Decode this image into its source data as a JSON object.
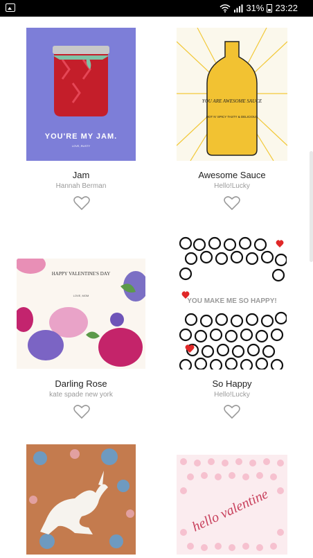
{
  "status_bar": {
    "battery": "31%",
    "time": "23:22"
  },
  "cards": [
    {
      "title": "Jam",
      "artist": "Hannah Berman",
      "image_text": "YOU'RE MY JAM.",
      "image_subtext": "LOVE, RUSTY"
    },
    {
      "title": "Awesome Sauce",
      "artist": "Hello!Lucky",
      "image_text": "YOU ARE AWESOME SAUCE",
      "image_subtext": "HOT N' SPICY TASTY & DELICIOUS"
    },
    {
      "title": "Darling Rose",
      "artist": "kate spade new york",
      "image_text": "HAPPY VALENTINE'S DAY",
      "image_subtext": "LOVE, MOM"
    },
    {
      "title": "So Happy",
      "artist": "Hello!Lucky",
      "image_text": "YOU MAKE ME SO HAPPY!",
      "image_subtext": ""
    },
    {
      "title": "",
      "artist": "",
      "image_text": "",
      "image_subtext": ""
    },
    {
      "title": "",
      "artist": "",
      "image_text": "hello valentine",
      "image_subtext": ""
    }
  ]
}
